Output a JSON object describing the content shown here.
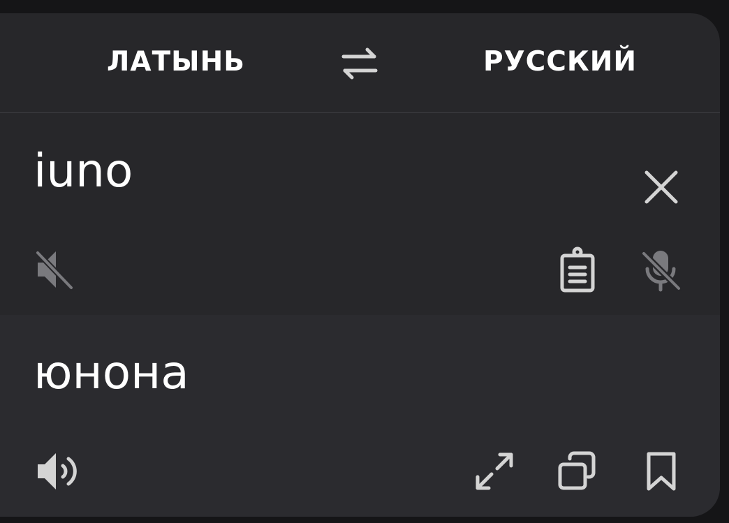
{
  "languages": {
    "source": "ЛАТЫНЬ",
    "target": "РУССКИЙ"
  },
  "input": {
    "text": "iuno"
  },
  "output": {
    "text": "юнона"
  },
  "icons": {
    "swap": "swap-arrows-icon",
    "clear": "close-icon",
    "speak_source_disabled": "speaker-muted-icon",
    "paste": "clipboard-icon",
    "mic_disabled": "microphone-off-icon",
    "speak_target": "speaker-icon",
    "fullscreen": "expand-icon",
    "copy": "copy-icon",
    "bookmark": "bookmark-icon"
  },
  "colors": {
    "background": "#151517",
    "card": "#27272a",
    "output_panel": "#2b2b2f",
    "icon": "#d4d4d4",
    "icon_disabled": "#7a7a7e",
    "text": "#ffffff"
  }
}
